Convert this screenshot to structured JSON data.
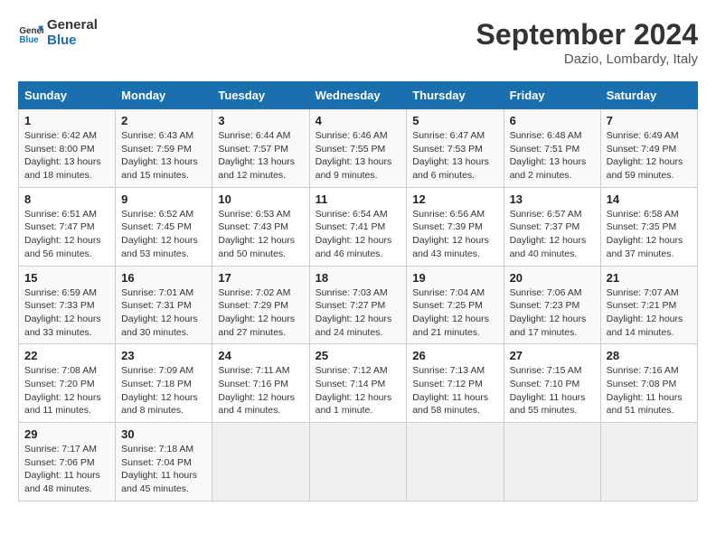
{
  "logo": {
    "line1": "General",
    "line2": "Blue"
  },
  "title": "September 2024",
  "location": "Dazio, Lombardy, Italy",
  "weekdays": [
    "Sunday",
    "Monday",
    "Tuesday",
    "Wednesday",
    "Thursday",
    "Friday",
    "Saturday"
  ],
  "weeks": [
    [
      {
        "day": "1",
        "info": "Sunrise: 6:42 AM\nSunset: 8:00 PM\nDaylight: 13 hours\nand 18 minutes."
      },
      {
        "day": "2",
        "info": "Sunrise: 6:43 AM\nSunset: 7:59 PM\nDaylight: 13 hours\nand 15 minutes."
      },
      {
        "day": "3",
        "info": "Sunrise: 6:44 AM\nSunset: 7:57 PM\nDaylight: 13 hours\nand 12 minutes."
      },
      {
        "day": "4",
        "info": "Sunrise: 6:46 AM\nSunset: 7:55 PM\nDaylight: 13 hours\nand 9 minutes."
      },
      {
        "day": "5",
        "info": "Sunrise: 6:47 AM\nSunset: 7:53 PM\nDaylight: 13 hours\nand 6 minutes."
      },
      {
        "day": "6",
        "info": "Sunrise: 6:48 AM\nSunset: 7:51 PM\nDaylight: 13 hours\nand 2 minutes."
      },
      {
        "day": "7",
        "info": "Sunrise: 6:49 AM\nSunset: 7:49 PM\nDaylight: 12 hours\nand 59 minutes."
      }
    ],
    [
      {
        "day": "8",
        "info": "Sunrise: 6:51 AM\nSunset: 7:47 PM\nDaylight: 12 hours\nand 56 minutes."
      },
      {
        "day": "9",
        "info": "Sunrise: 6:52 AM\nSunset: 7:45 PM\nDaylight: 12 hours\nand 53 minutes."
      },
      {
        "day": "10",
        "info": "Sunrise: 6:53 AM\nSunset: 7:43 PM\nDaylight: 12 hours\nand 50 minutes."
      },
      {
        "day": "11",
        "info": "Sunrise: 6:54 AM\nSunset: 7:41 PM\nDaylight: 12 hours\nand 46 minutes."
      },
      {
        "day": "12",
        "info": "Sunrise: 6:56 AM\nSunset: 7:39 PM\nDaylight: 12 hours\nand 43 minutes."
      },
      {
        "day": "13",
        "info": "Sunrise: 6:57 AM\nSunset: 7:37 PM\nDaylight: 12 hours\nand 40 minutes."
      },
      {
        "day": "14",
        "info": "Sunrise: 6:58 AM\nSunset: 7:35 PM\nDaylight: 12 hours\nand 37 minutes."
      }
    ],
    [
      {
        "day": "15",
        "info": "Sunrise: 6:59 AM\nSunset: 7:33 PM\nDaylight: 12 hours\nand 33 minutes."
      },
      {
        "day": "16",
        "info": "Sunrise: 7:01 AM\nSunset: 7:31 PM\nDaylight: 12 hours\nand 30 minutes."
      },
      {
        "day": "17",
        "info": "Sunrise: 7:02 AM\nSunset: 7:29 PM\nDaylight: 12 hours\nand 27 minutes."
      },
      {
        "day": "18",
        "info": "Sunrise: 7:03 AM\nSunset: 7:27 PM\nDaylight: 12 hours\nand 24 minutes."
      },
      {
        "day": "19",
        "info": "Sunrise: 7:04 AM\nSunset: 7:25 PM\nDaylight: 12 hours\nand 21 minutes."
      },
      {
        "day": "20",
        "info": "Sunrise: 7:06 AM\nSunset: 7:23 PM\nDaylight: 12 hours\nand 17 minutes."
      },
      {
        "day": "21",
        "info": "Sunrise: 7:07 AM\nSunset: 7:21 PM\nDaylight: 12 hours\nand 14 minutes."
      }
    ],
    [
      {
        "day": "22",
        "info": "Sunrise: 7:08 AM\nSunset: 7:20 PM\nDaylight: 12 hours\nand 11 minutes."
      },
      {
        "day": "23",
        "info": "Sunrise: 7:09 AM\nSunset: 7:18 PM\nDaylight: 12 hours\nand 8 minutes."
      },
      {
        "day": "24",
        "info": "Sunrise: 7:11 AM\nSunset: 7:16 PM\nDaylight: 12 hours\nand 4 minutes."
      },
      {
        "day": "25",
        "info": "Sunrise: 7:12 AM\nSunset: 7:14 PM\nDaylight: 12 hours\nand 1 minute."
      },
      {
        "day": "26",
        "info": "Sunrise: 7:13 AM\nSunset: 7:12 PM\nDaylight: 11 hours\nand 58 minutes."
      },
      {
        "day": "27",
        "info": "Sunrise: 7:15 AM\nSunset: 7:10 PM\nDaylight: 11 hours\nand 55 minutes."
      },
      {
        "day": "28",
        "info": "Sunrise: 7:16 AM\nSunset: 7:08 PM\nDaylight: 11 hours\nand 51 minutes."
      }
    ],
    [
      {
        "day": "29",
        "info": "Sunrise: 7:17 AM\nSunset: 7:06 PM\nDaylight: 11 hours\nand 48 minutes."
      },
      {
        "day": "30",
        "info": "Sunrise: 7:18 AM\nSunset: 7:04 PM\nDaylight: 11 hours\nand 45 minutes."
      },
      {
        "day": "",
        "info": ""
      },
      {
        "day": "",
        "info": ""
      },
      {
        "day": "",
        "info": ""
      },
      {
        "day": "",
        "info": ""
      },
      {
        "day": "",
        "info": ""
      }
    ]
  ]
}
